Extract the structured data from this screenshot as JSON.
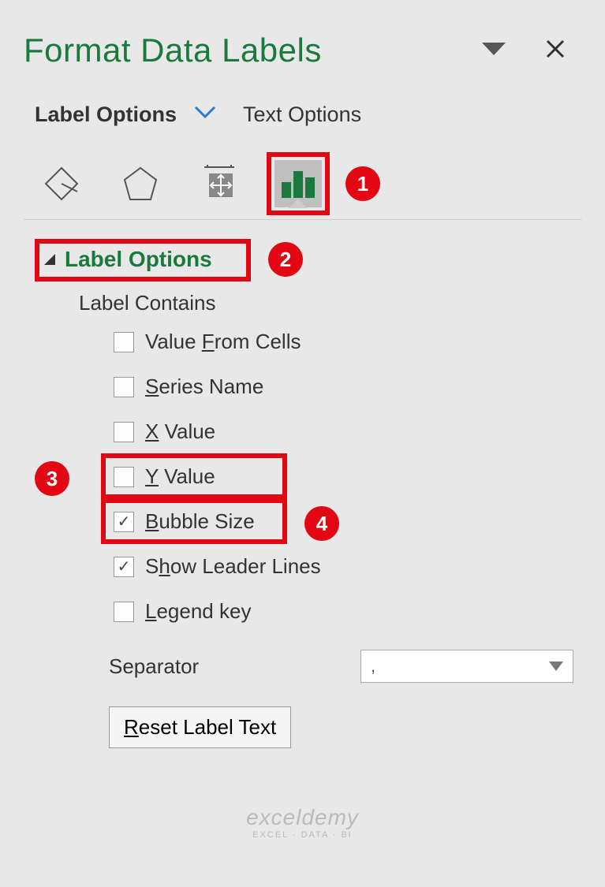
{
  "header": {
    "title": "Format Data Labels"
  },
  "tabs": {
    "label_options": "Label Options",
    "text_options": "Text Options"
  },
  "section": {
    "label_options_title": "Label Options",
    "label_contains": "Label Contains"
  },
  "checks": {
    "value_from_cells": {
      "pre": "Value ",
      "u": "F",
      "post": "rom Cells",
      "checked": false
    },
    "series_name": {
      "pre": "",
      "u": "S",
      "post": "eries Name",
      "checked": false
    },
    "x_value": {
      "pre": "",
      "u": "X",
      "post": " Value",
      "checked": false
    },
    "y_value": {
      "pre": "",
      "u": "Y",
      "post": " Value",
      "checked": false
    },
    "bubble_size": {
      "pre": "",
      "u": "B",
      "post": "ubble Size",
      "checked": true
    },
    "show_leader": {
      "pre": "S",
      "u": "h",
      "post": "ow Leader Lines",
      "checked": true
    },
    "legend_key": {
      "pre": "",
      "u": "L",
      "post": "egend key",
      "checked": false
    }
  },
  "separator": {
    "label": "Separator",
    "value": ","
  },
  "reset_button": {
    "pre": "",
    "u": "R",
    "post": "eset Label Text"
  },
  "badges": {
    "b1": "1",
    "b2": "2",
    "b3": "3",
    "b4": "4"
  },
  "watermark": {
    "line1": "exceldemy",
    "line2": "EXCEL · DATA · BI"
  }
}
